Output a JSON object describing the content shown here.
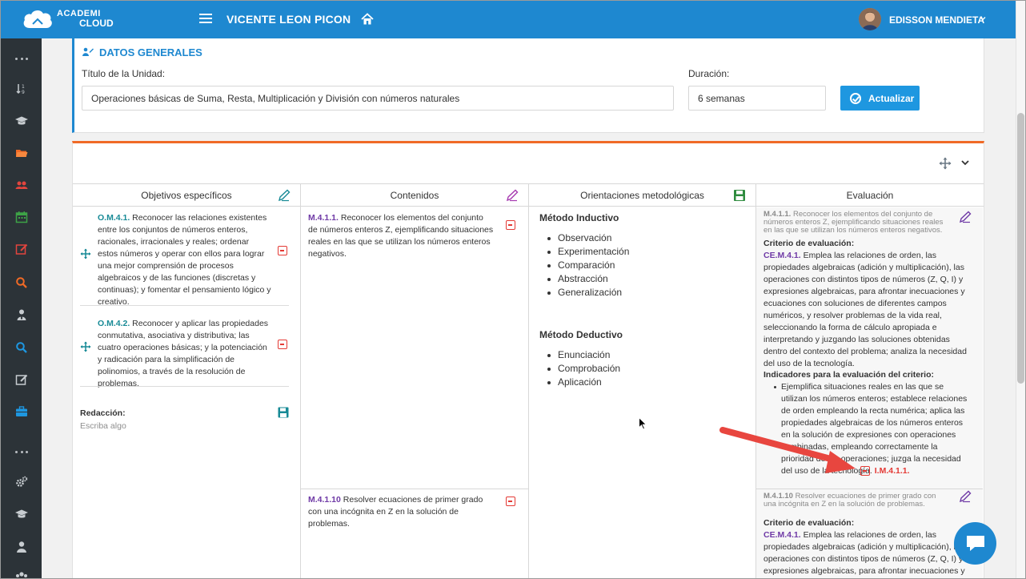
{
  "header": {
    "logo_top": "ACADEMI",
    "logo_bottom": "CLOUD",
    "school": "VICENTE LEON PICON",
    "user": "EDISSON MENDIETA"
  },
  "datos": {
    "title": "DATOS GENERALES",
    "titulo_label": "Título de la Unidad:",
    "titulo_value": "Operaciones básicas de Suma, Resta, Multiplicación y División con números naturales",
    "duracion_label": "Duración:",
    "duracion_value": "6 semanas",
    "actualizar": "Actualizar"
  },
  "grid": {
    "headers": [
      "Objetivos específicos",
      "Contenidos",
      "Orientaciones metodológicas",
      "Evaluación"
    ],
    "objetivos": [
      {
        "code": "O.M.4.1.",
        "text": " Reconocer las relaciones existentes entre los conjuntos de números enteros, racionales, irracionales y reales; ordenar estos números y operar con ellos para lograr una mejor comprensión de procesos algebraicos y de las funciones (discretas y continuas); y fomentar el pensamiento lógico y creativo."
      },
      {
        "code": "O.M.4.2.",
        "text": " Reconocer y aplicar las propiedades conmutativa, asociativa y distributiva; las cuatro operaciones básicas; y la potenciación y radicación para la simplificación de polinomios, a través de la resolución de problemas."
      }
    ],
    "redaccion_label": "Redacción:",
    "redaccion_placeholder": "Escriba algo",
    "contenidos": [
      {
        "code": "M.4.1.1.",
        "text": " Reconocer los elementos del conjunto de números enteros Z, ejemplificando situaciones reales en las que se utilizan los números enteros negativos."
      },
      {
        "code": "M.4.1.10",
        "text": " Resolver ecuaciones de primer grado con una incógnita en Z en la solución de problemas."
      }
    ],
    "metodos": [
      {
        "title": "Método Inductivo",
        "items": [
          "Observación",
          "Experimentación",
          "Comparación",
          "Abstracción",
          "Generalización"
        ]
      },
      {
        "title": "Método Deductivo",
        "items": [
          "Enunciación",
          "Comprobación",
          "Aplicación"
        ]
      }
    ],
    "evaluacion": {
      "e1_code": "M.4.1.1.",
      "e1_head": " Reconocer los elementos del conjunto de números enteros Z, ejemplificando situaciones reales en las que se utilizan los números enteros negativos.",
      "criterio_label": "Criterio de evaluación:",
      "ce_code": "CE.M.4.1.",
      "ce_text": " Emplea las relaciones de orden, las propiedades algebraicas (adición y multiplicación), las operaciones con distintos tipos de números (Z, Q, I) y expresiones algebraicas, para afrontar inecuaciones y ecuaciones con soluciones de diferentes campos numéricos, y resolver problemas de la vida real, seleccionando la forma de cálculo apropiada e interpretando y juzgando las soluciones obtenidas dentro del contexto del problema; analiza la necesidad del uso de la tecnología.",
      "indicadores_label": "Indicadores para la evaluación del criterio:",
      "ind_text": "Ejemplifica situaciones reales en las que se utilizan los números enteros; establece relaciones de orden empleando la recta numérica; aplica las propiedades algebraicas de los números enteros en la solución de expresiones con operaciones combinadas, empleando correctamente la prioridad de las operaciones; juzga la necesidad del uso de la tecnología.",
      "ind_code": "I.M.4.1.1.",
      "e2_code": "M.4.1.10",
      "e2_head": " Resolver ecuaciones de primer grado con una incógnita en Z en la solución de problemas.",
      "criterio_label_2": "Criterio de evaluación:",
      "ce_code_2": "CE.M.4.1.",
      "ce_text_2": " Emplea las relaciones de orden, las propiedades algebraicas (adición y multiplicación), las operaciones con distintos tipos de números (Z, Q, I) y expresiones algebraicas, para afrontar inecuaciones y ecuaciones con soluciones de diferentes campos numéricos"
    }
  },
  "colors": {
    "primary": "#1e88d0",
    "accent": "#f06a26",
    "sidebar": "#2c3338",
    "danger": "#e43a35",
    "teal": "#178a96",
    "purple": "#6f3aa6"
  },
  "icons": {
    "sidebar": [
      "more-icon",
      "sort-icon",
      "graduation-cap-icon",
      "folder-icon",
      "users-icon",
      "calendar-icon",
      "edit-icon",
      "search-icon",
      "user-tie-icon",
      "search-icon",
      "edit-icon",
      "briefcase-icon",
      "more-icon",
      "cogs-icon",
      "graduation-cap-icon",
      "user-icon",
      "group-icon"
    ]
  }
}
